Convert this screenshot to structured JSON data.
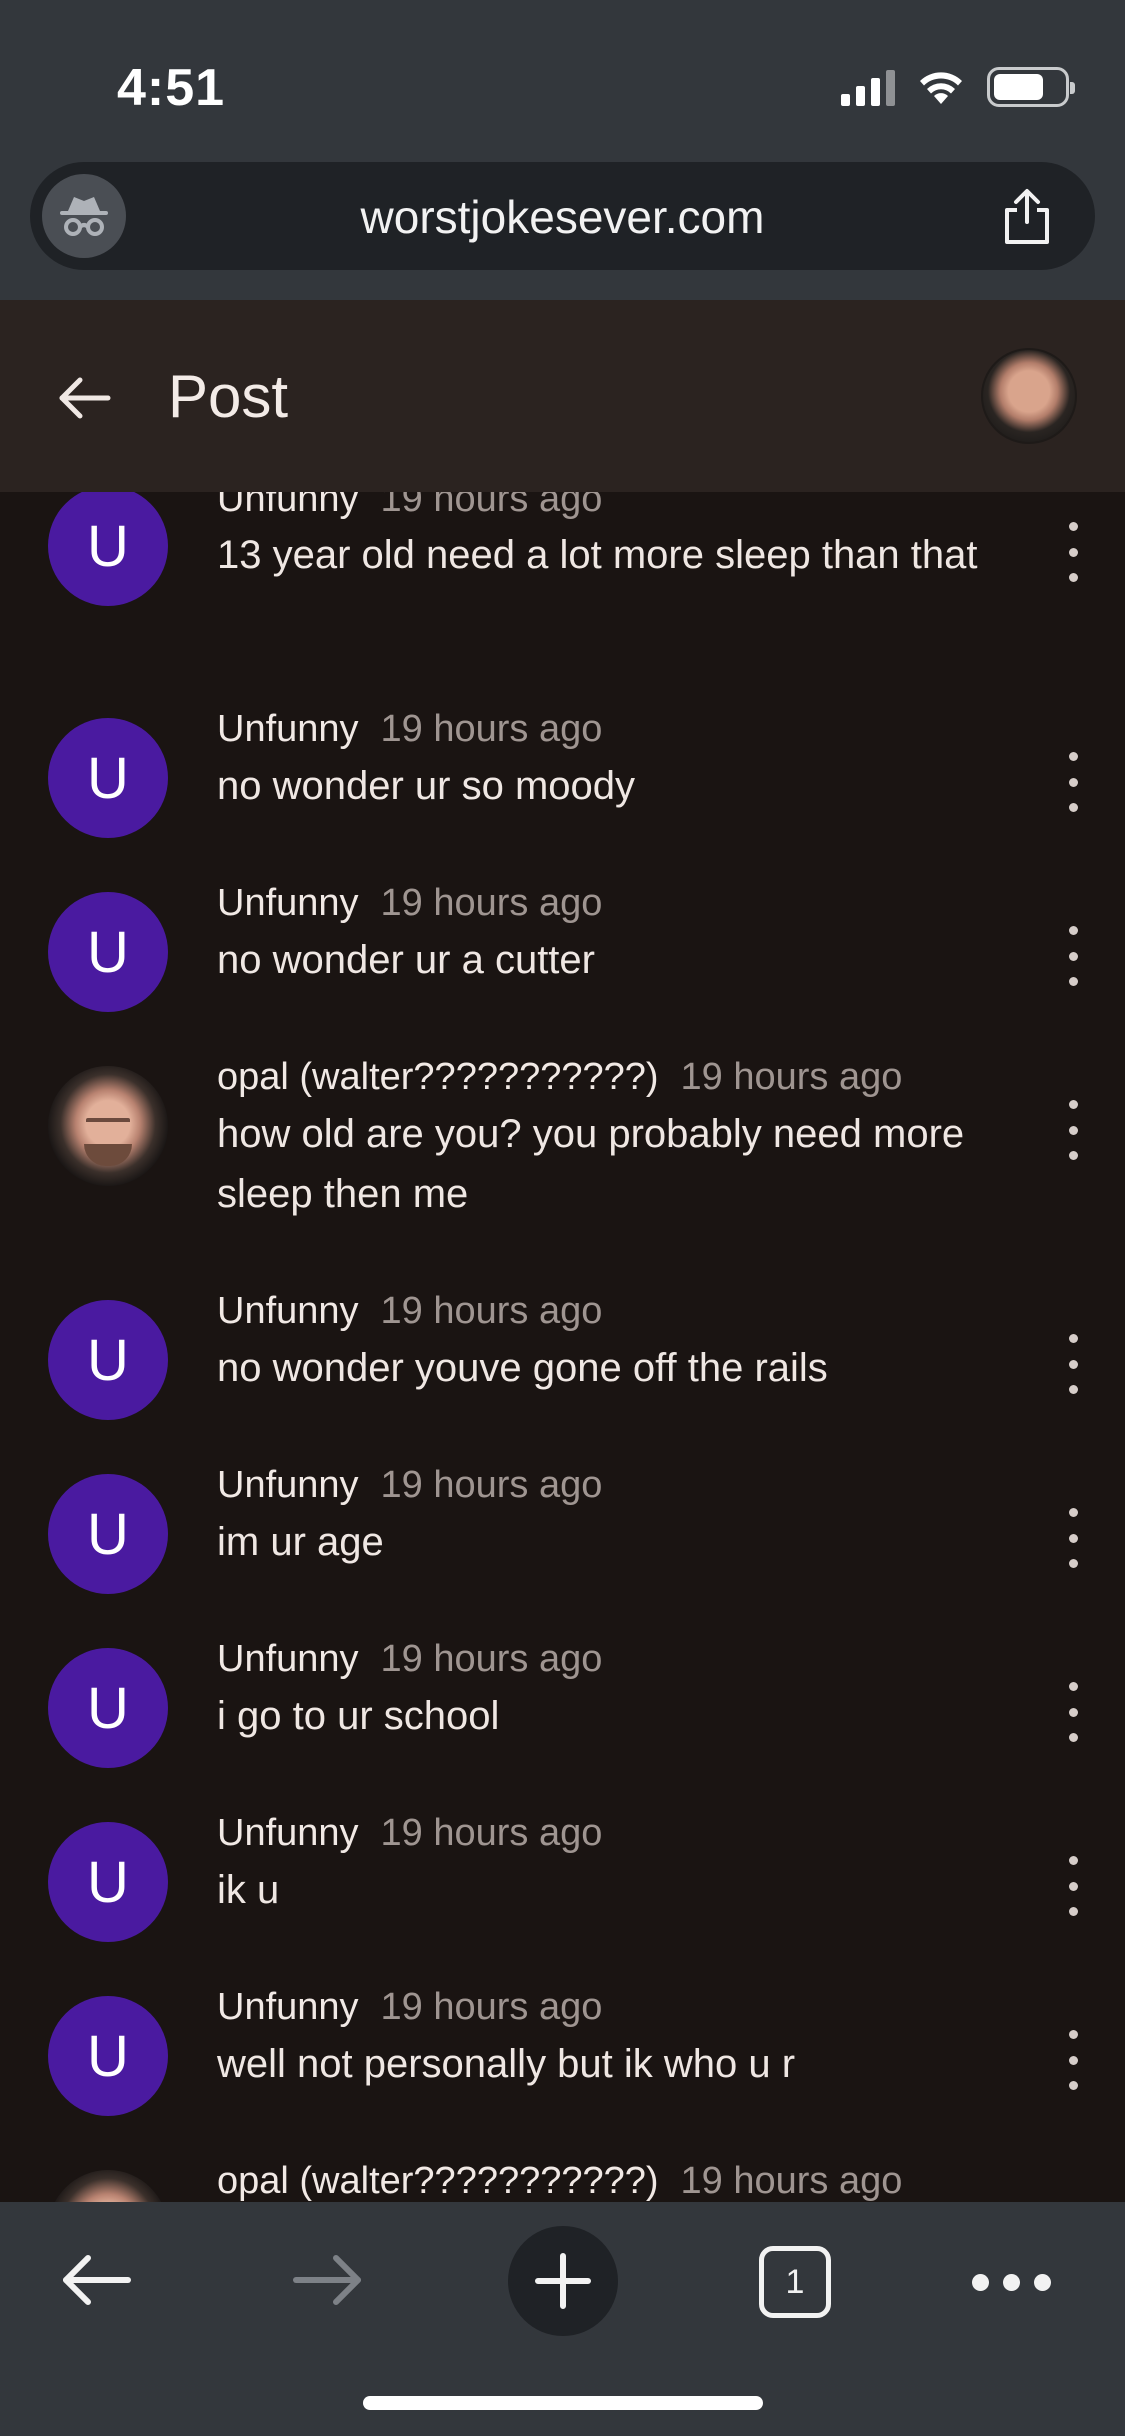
{
  "status_bar": {
    "time": "4:51"
  },
  "browser": {
    "url": "worstjokesever.com",
    "tab_count": "1"
  },
  "header": {
    "title": "Post"
  },
  "comments": [
    {
      "author": "Unfunny",
      "time": "19 hours ago",
      "text": "13 year old need a lot more sleep than that",
      "avatar_letter": "U"
    },
    {
      "author": "Unfunny",
      "time": "19 hours ago",
      "text": "no wonder ur so moody",
      "avatar_letter": "U"
    },
    {
      "author": "Unfunny",
      "time": "19 hours ago",
      "text": "no wonder ur a cutter",
      "avatar_letter": "U"
    },
    {
      "author": "opal (walter???????????)",
      "time": "19 hours ago",
      "text": "how old are you? you probably need more sleep then me",
      "avatar_letter": ""
    },
    {
      "author": "Unfunny",
      "time": "19 hours ago",
      "text": "no wonder youve gone off the rails",
      "avatar_letter": "U"
    },
    {
      "author": "Unfunny",
      "time": "19 hours ago",
      "text": "im ur age",
      "avatar_letter": "U"
    },
    {
      "author": "Unfunny",
      "time": "19 hours ago",
      "text": "i go to ur school",
      "avatar_letter": "U"
    },
    {
      "author": "Unfunny",
      "time": "19 hours ago",
      "text": "ik u",
      "avatar_letter": "U"
    },
    {
      "author": "Unfunny",
      "time": "19 hours ago",
      "text": "well not personally but ik who u r",
      "avatar_letter": "U"
    },
    {
      "author": "opal (walter???????????)",
      "time": "19 hours ago",
      "text": "",
      "avatar_letter": ""
    }
  ],
  "colors": {
    "avatar_purple": "#4a1aa0",
    "page_background": "#1a1412",
    "header_background": "#2b2320",
    "browser_chrome": "#33373c"
  },
  "icons": [
    "incognito-icon",
    "share-icon",
    "back-arrow-icon",
    "forward-arrow-icon",
    "plus-icon",
    "tabs-icon",
    "more-icon",
    "kebab-menu-icon"
  ]
}
